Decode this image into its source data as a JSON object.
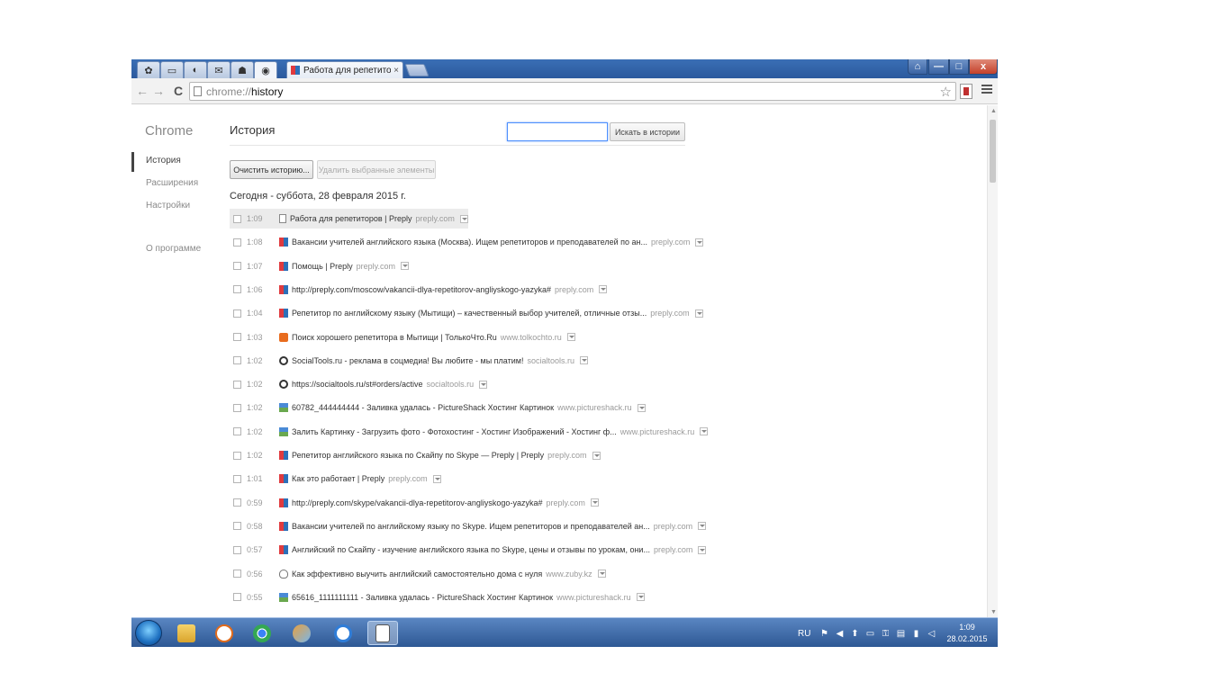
{
  "tabs": {
    "active_title": "Работа для репетиторов",
    "close_glyph": "×"
  },
  "window": {
    "min_glyph": "—",
    "max_glyph": "□",
    "close_glyph": "x"
  },
  "toolbar": {
    "back_glyph": "←",
    "forward_glyph": "→",
    "reload_glyph": "C",
    "url_scheme": "chrome://",
    "url_host": "history",
    "star_glyph": "☆"
  },
  "sidebar": {
    "brand": "Chrome",
    "items": [
      {
        "label": "История"
      },
      {
        "label": "Расширения"
      },
      {
        "label": "Настройки"
      },
      {
        "label": "О программе"
      }
    ]
  },
  "main": {
    "title": "История",
    "search_value": "",
    "search_button": "Искать в истории",
    "clear_button": "Очистить историю...",
    "delete_button": "Удалить выбранные элементы",
    "day_heading": "Сегодня - суббота, 28 февраля 2015 г.",
    "entries": [
      {
        "time": "1:09",
        "icon": "page",
        "title": "Работа для репетиторов | Preply",
        "domain": "preply.com"
      },
      {
        "time": "1:08",
        "icon": "preply",
        "title": "Вакансии учителей английского языка (Москва). Ищем репетиторов и преподавателей по ан...",
        "domain": "preply.com"
      },
      {
        "time": "1:07",
        "icon": "preply",
        "title": "Помощь | Preply",
        "domain": "preply.com"
      },
      {
        "time": "1:06",
        "icon": "preply",
        "title": "http://preply.com/moscow/vakancii-dlya-repetitorov-angliyskogo-yazyka#",
        "domain": "preply.com"
      },
      {
        "time": "1:04",
        "icon": "preply",
        "title": "Репетитор по английскому языку (Мытищи) – качественный выбор учителей, отличные отзы...",
        "domain": "preply.com"
      },
      {
        "time": "1:03",
        "icon": "tolko",
        "title": "Поиск хорошего репетитора в Мытищи | ТолькоЧто.Ru",
        "domain": "www.tolkochto.ru"
      },
      {
        "time": "1:02",
        "icon": "social",
        "title": "SocialTools.ru - реклама в соцмедиа! Вы любите - мы платим!",
        "domain": "socialtools.ru"
      },
      {
        "time": "1:02",
        "icon": "social",
        "title": "https://socialtools.ru/st#orders/active",
        "domain": "socialtools.ru"
      },
      {
        "time": "1:02",
        "icon": "pshack",
        "title": "60782_444444444 - Заливка удалась - PictureShack Хостинг Картинок",
        "domain": "www.pictureshack.ru"
      },
      {
        "time": "1:02",
        "icon": "pshack",
        "title": "Залить Картинку - Загрузить фото - Фотохостинг - Хостинг Изображений - Хостинг ф...",
        "domain": "www.pictureshack.ru"
      },
      {
        "time": "1:02",
        "icon": "preply",
        "title": "Репетитор английского языка по Скайпу по Skype — Preply | Preply",
        "domain": "preply.com"
      },
      {
        "time": "1:01",
        "icon": "preply",
        "title": "Как это работает | Preply",
        "domain": "preply.com"
      },
      {
        "time": "0:59",
        "icon": "preply",
        "title": "http://preply.com/skype/vakancii-dlya-repetitorov-angliyskogo-yazyka#",
        "domain": "preply.com"
      },
      {
        "time": "0:58",
        "icon": "preply",
        "title": "Вакансии учителей по английскому языку по Skype. Ищем репетиторов и преподавателей ан...",
        "domain": "preply.com"
      },
      {
        "time": "0:57",
        "icon": "preply",
        "title": "Английский по Скайпу - изучение английского языка по Skype, цены и отзывы по урокам, они...",
        "domain": "preply.com"
      },
      {
        "time": "0:56",
        "icon": "zuby",
        "title": "Как эффективно выучить английский самостоятельно дома с нуля",
        "domain": "www.zuby.kz"
      },
      {
        "time": "0:55",
        "icon": "pshack",
        "title": "65616_1111111111 - Заливка удалась - PictureShack Хостинг Картинок",
        "domain": "www.pictureshack.ru"
      }
    ]
  },
  "taskbar": {
    "language": "RU",
    "clock_time": "1:09",
    "clock_date": "28.02.2015"
  }
}
